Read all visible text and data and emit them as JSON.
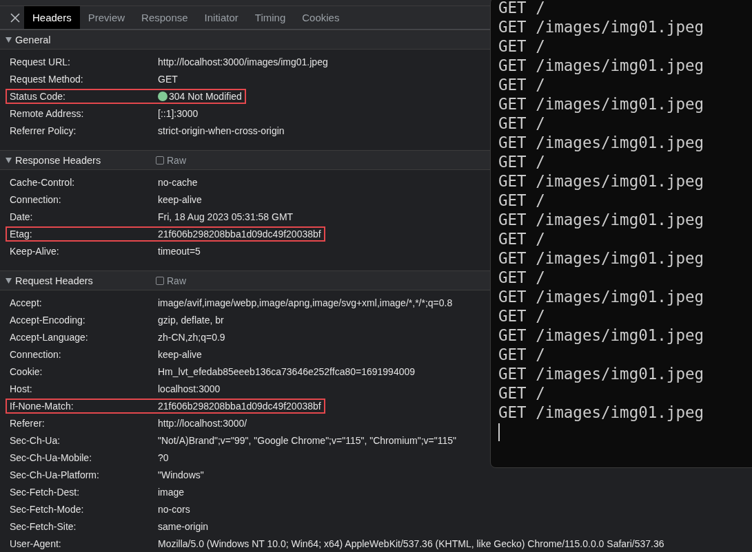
{
  "tabs": [
    {
      "label": "Headers",
      "selected": true
    },
    {
      "label": "Preview",
      "selected": false
    },
    {
      "label": "Response",
      "selected": false
    },
    {
      "label": "Initiator",
      "selected": false
    },
    {
      "label": "Timing",
      "selected": false
    },
    {
      "label": "Cookies",
      "selected": false
    }
  ],
  "sections": [
    {
      "title": "General",
      "expanded": true,
      "rows": [
        {
          "name": "Request URL:",
          "value": "http://localhost:3000/images/img01.jpeg",
          "highlighted": false
        },
        {
          "name": "Request Method:",
          "value": "GET",
          "highlighted": false
        },
        {
          "name": "Status Code:",
          "value": "304 Not Modified",
          "highlighted": true,
          "color": "#81c995"
        },
        {
          "name": "Remote Address:",
          "value": "[::1]:3000",
          "highlighted": false
        },
        {
          "name": "Referrer Policy:",
          "value": "strict-origin-when-cross-origin",
          "highlighted": false
        }
      ]
    },
    {
      "title": "Response Headers",
      "expanded": true,
      "raw": {
        "label": "Raw",
        "checked": false
      },
      "rows": [
        {
          "name": "Cache-Control:",
          "value": "no-cache",
          "highlighted": false
        },
        {
          "name": "Connection:",
          "value": "keep-alive",
          "highlighted": false
        },
        {
          "name": "Date:",
          "value": "Fri, 18 Aug 2023 05:31:58 GMT",
          "highlighted": false
        },
        {
          "name": "Etag:",
          "value": "21f606b298208bba1d09dc49f20038bf",
          "highlighted": true
        },
        {
          "name": "Keep-Alive:",
          "value": "timeout=5",
          "highlighted": false
        }
      ]
    },
    {
      "title": "Request Headers",
      "expanded": true,
      "raw": {
        "label": "Raw",
        "checked": false
      },
      "rows": [
        {
          "name": "Accept:",
          "value": "image/avif,image/webp,image/apng,image/svg+xml,image/*,*/*;q=0.8",
          "highlighted": false
        },
        {
          "name": "Accept-Encoding:",
          "value": "gzip, deflate, br",
          "highlighted": false
        },
        {
          "name": "Accept-Language:",
          "value": "zh-CN,zh;q=0.9",
          "highlighted": false
        },
        {
          "name": "Connection:",
          "value": "keep-alive",
          "highlighted": false
        },
        {
          "name": "Cookie:",
          "value": "Hm_lvt_efedab85eeeb136ca73646e252ffca80=1691994009",
          "highlighted": false
        },
        {
          "name": "Host:",
          "value": "localhost:3000",
          "highlighted": false
        },
        {
          "name": "If-None-Match:",
          "value": "21f606b298208bba1d09dc49f20038bf",
          "highlighted": true
        },
        {
          "name": "Referer:",
          "value": "http://localhost:3000/",
          "highlighted": false
        },
        {
          "name": "Sec-Ch-Ua:",
          "value": "\"Not/A)Brand\";v=\"99\", \"Google Chrome\";v=\"115\", \"Chromium\";v=\"115\"",
          "highlighted": false
        },
        {
          "name": "Sec-Ch-Ua-Mobile:",
          "value": "?0",
          "highlighted": false
        },
        {
          "name": "Sec-Ch-Ua-Platform:",
          "value": "\"Windows\"",
          "highlighted": false
        },
        {
          "name": "Sec-Fetch-Dest:",
          "value": "image",
          "highlighted": false
        },
        {
          "name": "Sec-Fetch-Mode:",
          "value": "no-cors",
          "highlighted": false
        },
        {
          "name": "Sec-Fetch-Site:",
          "value": "same-origin",
          "highlighted": false
        },
        {
          "name": "User-Agent:",
          "value": "Mozilla/5.0 (Windows NT 10.0; Win64; x64) AppleWebKit/537.36 (KHTML, like Gecko) Chrome/115.0.0.0 Safari/537.36",
          "highlighted": false
        }
      ]
    }
  ],
  "terminal": {
    "lines": [
      "GET /",
      "GET /images/img01.jpeg",
      "GET /",
      "GET /images/img01.jpeg",
      "GET /",
      "GET /images/img01.jpeg",
      "GET /",
      "GET /images/img01.jpeg",
      "GET /",
      "GET /images/img01.jpeg",
      "GET /",
      "GET /images/img01.jpeg",
      "GET /",
      "GET /images/img01.jpeg",
      "GET /",
      "GET /images/img01.jpeg",
      "GET /",
      "GET /images/img01.jpeg",
      "GET /",
      "GET /images/img01.jpeg",
      "GET /",
      "GET /images/img01.jpeg"
    ]
  }
}
